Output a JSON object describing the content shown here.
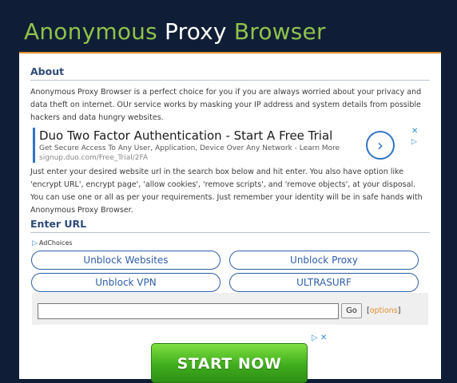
{
  "header": {
    "title_part1": "Anonymous",
    "title_part2": "Proxy",
    "title_part3": "Browser"
  },
  "about": {
    "heading": "About",
    "intro": "Anonymous Proxy Browser is a perfect choice for you if you are always worried about your privacy and data theft on internet. OUr service works by masking your IP address and system details from possible hackers and data hungry websites.",
    "details": "Just enter your desired website url in the search box below and hit enter. You also have option like 'encrypt URL', encrypt page', 'allow cookies', 'remove scripts', and 'remove objects', at your disposal. You can use one or all as per your requirements. Just remember your identity will be in safe hands with Anonymous Proxy Browser."
  },
  "ad": {
    "title": "Duo Two Factor Authentication - Start A Free Trial",
    "description": "Get Secure Access To Any User, Application, Device Over Any Network - Learn More",
    "url": "signup.duo.com/Free_Trial/2FA",
    "arrow_icon": "›",
    "close_icon": "✕",
    "play_icon": "▷"
  },
  "enter_url": {
    "heading": "Enter URL",
    "adchoices_icon": "▷",
    "adchoices_label": "AdChoices",
    "links": [
      "Unblock Websites",
      "Unblock Proxy",
      "Unblock VPN",
      "ULTRASURF"
    ],
    "input_value": "",
    "go_label": "Go",
    "options_open": "[",
    "options_label": "options",
    "options_close": "]"
  },
  "banner": {
    "icons": "▷ ✕",
    "button_label": "START NOW"
  },
  "colors": {
    "background": "#0f1e36",
    "title_green": "#8fc24a",
    "accent_orange": "#e1902c",
    "heading_blue": "#2e4b7a",
    "link_blue": "#2e5ea8"
  }
}
